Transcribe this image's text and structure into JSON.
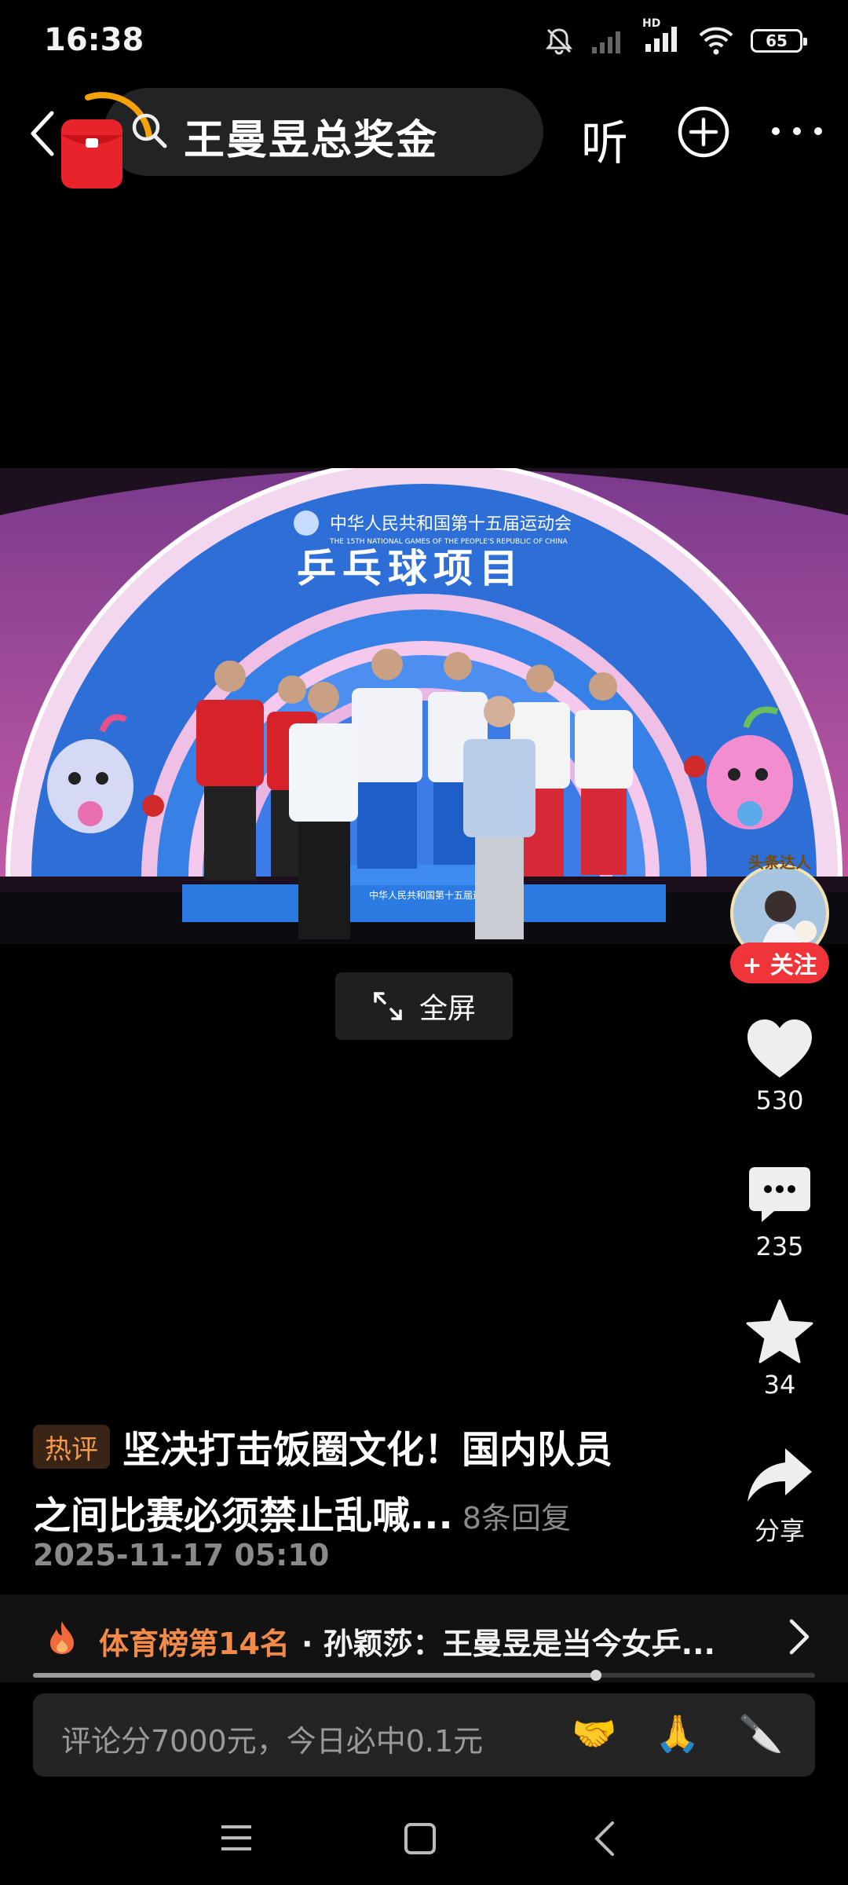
{
  "status_bar": {
    "time": "16:38",
    "battery": "65",
    "network_label": "HD"
  },
  "top_bar": {
    "search_query": "王曼昱总奖金",
    "listen_label": "听"
  },
  "video": {
    "banner_title": "中华人民共和国第十五届运动会",
    "banner_subtitle": "THE 15TH NATIONAL GAMES OF THE PEOPLE'S REPUBLIC OF CHINA",
    "banner_event": "乒乓球项目",
    "podium_label": "中华人民共和国第十五届运动会",
    "fullscreen_label": "全屏"
  },
  "author": {
    "badge": "头条达人",
    "follow_label": "+ 关注"
  },
  "actions": {
    "likes": "530",
    "comments": "235",
    "favorites": "34",
    "share_label": "分享"
  },
  "caption": {
    "tag": "热评",
    "line1": "坚决打击饭圈文化！国内队员",
    "line2": "之间比赛必须禁止乱喊...",
    "replies": "8条回复",
    "date": "2025-11-17 05:10"
  },
  "hot_list": {
    "rank": "体育榜第14名",
    "headline": "· 孙颖莎：王曼昱是当今女乒...",
    "progress": 0.72
  },
  "comment_input": {
    "placeholder": "评论分7000元，今日必中0.1元",
    "emojis": [
      "🤝",
      "🙏",
      "🔪"
    ]
  },
  "colors": {
    "accent_orange": "#f28a48",
    "follow_red": "#f0353a",
    "background": "#000000"
  }
}
